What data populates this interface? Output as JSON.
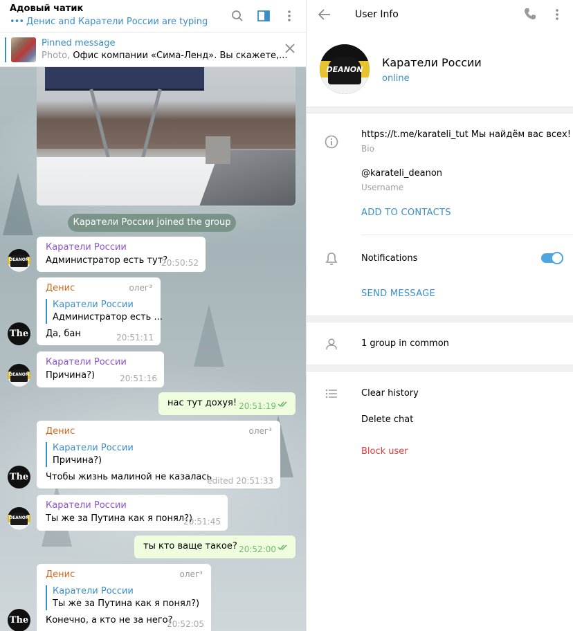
{
  "chat": {
    "title": "Адовый чатик",
    "typing": "Денис and Каратели России are typing",
    "pinned": {
      "label": "Pinned message",
      "type": "Photo,",
      "text": "Офис компании «Сима-Ленд». Вы скажете,..."
    },
    "service_message": "Каратели России joined the group",
    "messages": [
      {
        "sender": "Каратели России",
        "text": "Администратор есть тут?",
        "time": "20:50:52"
      },
      {
        "sender": "Денис",
        "tag": "олег³",
        "reply_name": "Каратели России",
        "reply_text": "Администратор есть ...",
        "text": "Да, бан",
        "time": "20:51:11"
      },
      {
        "sender": "Каратели России",
        "text": "Причина?)",
        "time": "20:51:16"
      },
      {
        "text": "нас тут дохуя!",
        "time": "20:51:19"
      },
      {
        "sender": "Денис",
        "tag": "олег³",
        "reply_name": "Каратели России",
        "reply_text": "Причина?)",
        "text": "Чтобы жизнь малиной не казалась",
        "time": "edited 20:51:33"
      },
      {
        "sender": "Каратели России",
        "text": "Ты же за Путина как я понял?)",
        "time": "20:51:45"
      },
      {
        "text": "ты кто ваще такое?",
        "time": "20:52:00"
      },
      {
        "sender": "Денис",
        "tag": "олег³",
        "reply_name": "Каратели России",
        "reply_text": "Ты же за Путина как я понял?)",
        "text": "Конечно, а кто не за него?",
        "time": "20:52:05"
      }
    ],
    "avatar_the": "The",
    "avatar_karateli": "DEANON"
  },
  "info": {
    "title": "User Info",
    "name": "Каратели России",
    "status": "online",
    "avatar_label": "DEANON",
    "bio": "https://t.me/karateli_tut Мы найдём вас всех!",
    "bio_label": "Bio",
    "username": "@karateli_deanon",
    "username_label": "Username",
    "add_contacts": "ADD TO CONTACTS",
    "notifications": "Notifications",
    "notifications_on": true,
    "send_message": "SEND MESSAGE",
    "groups_common": "1 group in common",
    "clear_history": "Clear history",
    "delete_chat": "Delete chat",
    "block_user": "Block user"
  },
  "colors": {
    "accent": "#3a8ec5",
    "danger": "#e53935",
    "outgoing_bubble": "#effdde",
    "sender_karateli": "#8e54c9",
    "sender_denis": "#d2691e"
  },
  "icons": [
    "search-icon",
    "sidebar-toggle-icon",
    "more-vertical-icon",
    "close-icon",
    "back-arrow-icon",
    "phone-icon",
    "info-icon",
    "bell-icon",
    "user-icon",
    "list-icon",
    "double-check-icon"
  ]
}
